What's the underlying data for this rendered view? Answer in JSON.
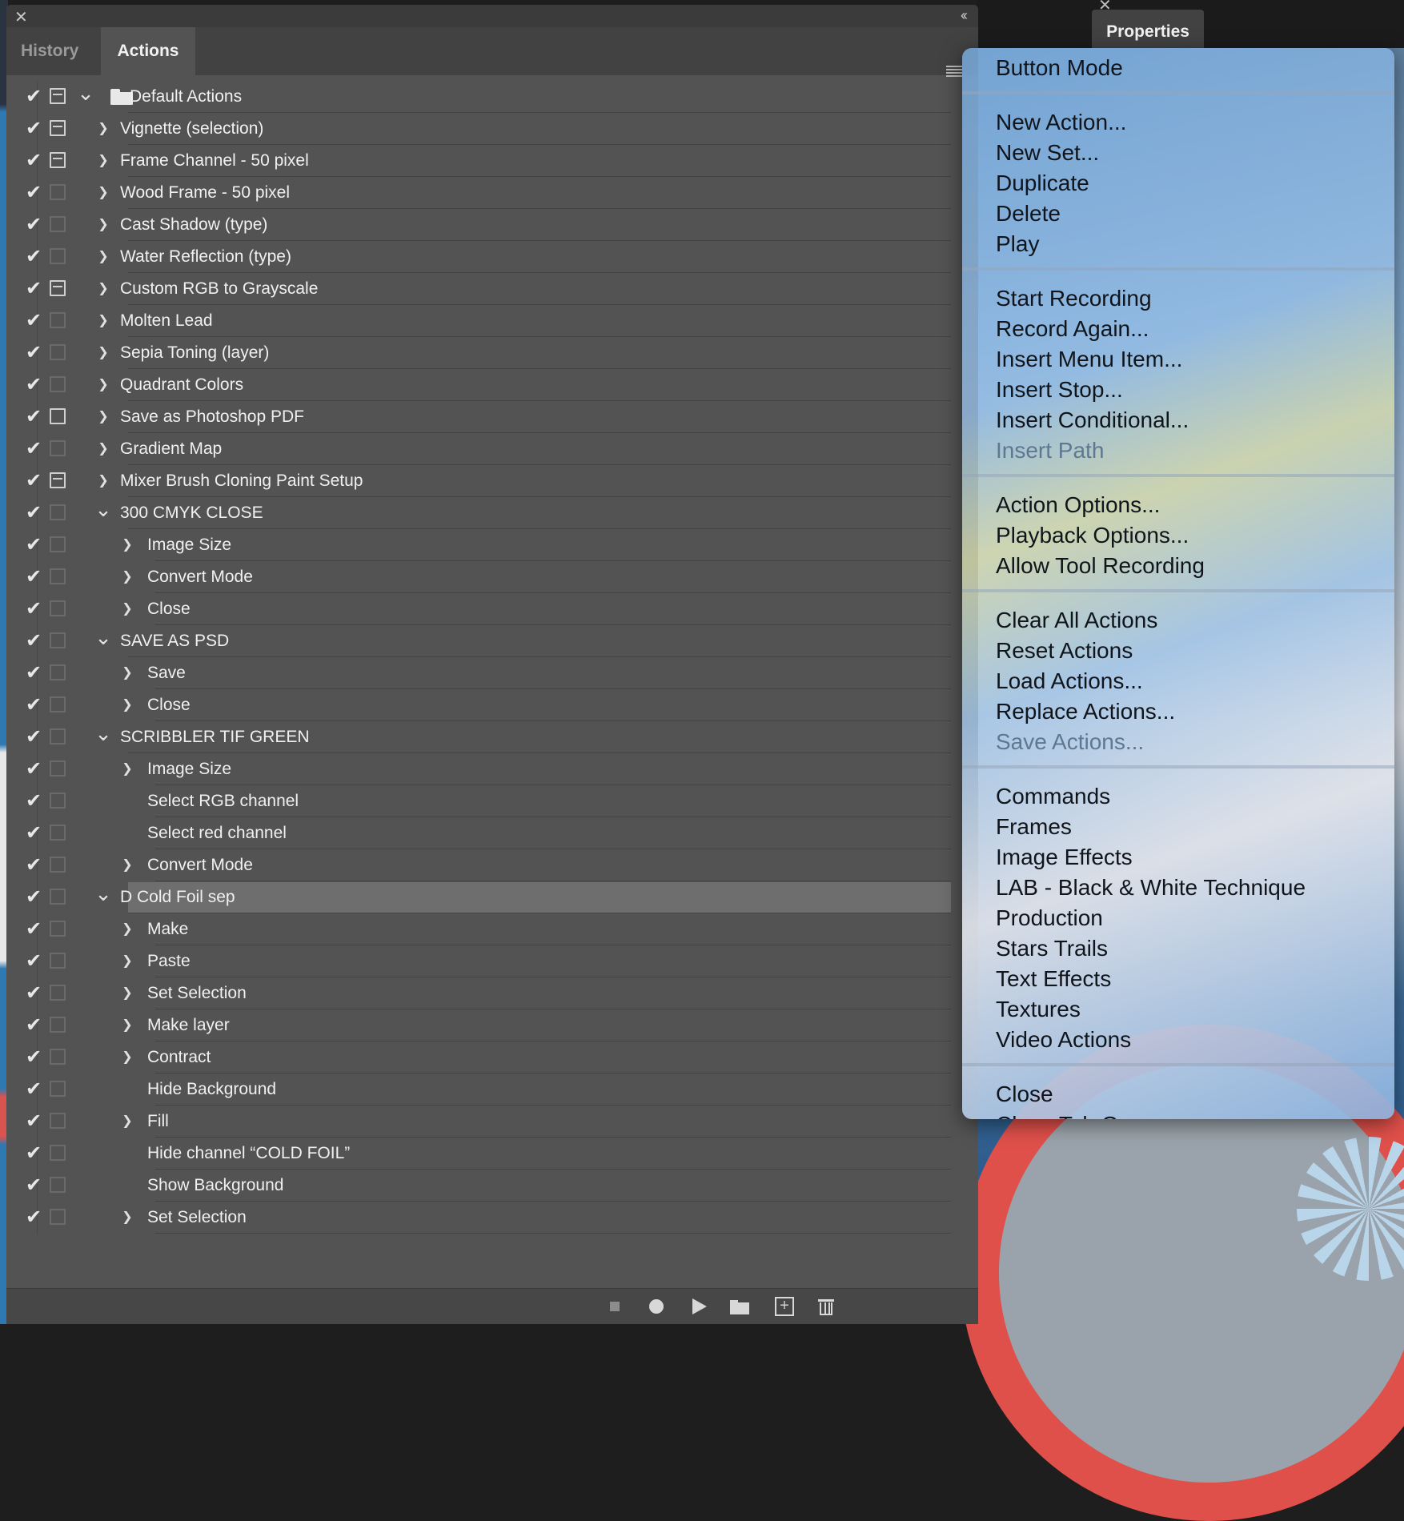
{
  "panel": {
    "tabs": [
      {
        "label": "History",
        "active": false
      },
      {
        "label": "Actions",
        "active": true
      }
    ],
    "close_glyph": "✕",
    "collapse_glyph": "‹‹"
  },
  "properties_tab": {
    "label": "Properties"
  },
  "actions": [
    {
      "label": "Default Actions",
      "level": 0,
      "kind": "set",
      "expanded": true,
      "dialog": true,
      "checked": true
    },
    {
      "label": "Vignette (selection)",
      "level": 0,
      "expanded": false,
      "dialog": true,
      "checked": true
    },
    {
      "label": "Frame Channel - 50 pixel",
      "level": 0,
      "expanded": false,
      "dialog": true,
      "checked": true
    },
    {
      "label": "Wood Frame - 50 pixel",
      "level": 0,
      "expanded": false,
      "dialog": false,
      "checked": true
    },
    {
      "label": "Cast Shadow (type)",
      "level": 0,
      "expanded": false,
      "dialog": false,
      "checked": true
    },
    {
      "label": "Water Reflection (type)",
      "level": 0,
      "expanded": false,
      "dialog": false,
      "checked": true
    },
    {
      "label": "Custom RGB to Grayscale",
      "level": 0,
      "expanded": false,
      "dialog": true,
      "checked": true
    },
    {
      "label": "Molten Lead",
      "level": 0,
      "expanded": false,
      "dialog": false,
      "checked": true
    },
    {
      "label": "Sepia Toning (layer)",
      "level": 0,
      "expanded": false,
      "dialog": false,
      "checked": true
    },
    {
      "label": "Quadrant Colors",
      "level": 0,
      "expanded": false,
      "dialog": false,
      "checked": true
    },
    {
      "label": "Save as Photoshop PDF",
      "level": 0,
      "expanded": false,
      "dialog": "empty-on",
      "checked": true
    },
    {
      "label": "Gradient Map",
      "level": 0,
      "expanded": false,
      "dialog": false,
      "checked": true
    },
    {
      "label": "Mixer Brush Cloning Paint Setup",
      "level": 0,
      "expanded": false,
      "dialog": true,
      "checked": true
    },
    {
      "label": "300 CMYK CLOSE",
      "level": 0,
      "expanded": true,
      "dialog": false,
      "checked": true
    },
    {
      "label": "Image Size",
      "level": 1,
      "expanded": false,
      "dialog": false,
      "checked": true
    },
    {
      "label": "Convert Mode",
      "level": 1,
      "expanded": false,
      "dialog": false,
      "checked": true
    },
    {
      "label": "Close",
      "level": 1,
      "expanded": false,
      "dialog": false,
      "checked": true
    },
    {
      "label": "SAVE AS PSD",
      "level": 0,
      "expanded": true,
      "dialog": false,
      "checked": true
    },
    {
      "label": "Save",
      "level": 1,
      "expanded": false,
      "dialog": false,
      "checked": true
    },
    {
      "label": "Close",
      "level": 1,
      "expanded": false,
      "dialog": false,
      "checked": true
    },
    {
      "label": "SCRIBBLER TIF GREEN",
      "level": 0,
      "expanded": true,
      "dialog": false,
      "checked": true
    },
    {
      "label": "Image Size",
      "level": 1,
      "expanded": false,
      "dialog": false,
      "checked": true
    },
    {
      "label": "Select RGB channel",
      "level": 1,
      "expanded": null,
      "dialog": false,
      "checked": true
    },
    {
      "label": "Select red channel",
      "level": 1,
      "expanded": null,
      "dialog": false,
      "checked": true
    },
    {
      "label": "Convert Mode",
      "level": 1,
      "expanded": false,
      "dialog": false,
      "checked": true
    },
    {
      "label": "D Cold Foil sep",
      "level": 0,
      "expanded": true,
      "dialog": false,
      "checked": true,
      "selected": true
    },
    {
      "label": "Make",
      "level": 1,
      "expanded": false,
      "dialog": false,
      "checked": true
    },
    {
      "label": "Paste",
      "level": 1,
      "expanded": false,
      "dialog": false,
      "checked": true
    },
    {
      "label": "Set Selection",
      "level": 1,
      "expanded": false,
      "dialog": false,
      "checked": true
    },
    {
      "label": "Make layer",
      "level": 1,
      "expanded": false,
      "dialog": false,
      "checked": true
    },
    {
      "label": "Contract",
      "level": 1,
      "expanded": false,
      "dialog": false,
      "checked": true
    },
    {
      "label": "Hide Background",
      "level": 1,
      "expanded": null,
      "dialog": false,
      "checked": true
    },
    {
      "label": "Fill",
      "level": 1,
      "expanded": false,
      "dialog": false,
      "checked": true
    },
    {
      "label": "Hide channel “COLD FOIL”",
      "level": 1,
      "expanded": null,
      "dialog": false,
      "checked": true
    },
    {
      "label": "Show Background",
      "level": 1,
      "expanded": null,
      "dialog": false,
      "checked": true
    },
    {
      "label": "Set Selection",
      "level": 1,
      "expanded": false,
      "dialog": false,
      "checked": true
    }
  ],
  "bottom_bar": [
    "stop-icon",
    "record-icon",
    "play-icon",
    "new-set-icon",
    "new-action-icon",
    "trash-icon"
  ],
  "menu": {
    "groups": [
      [
        {
          "label": "Button Mode"
        }
      ],
      [
        {
          "label": "New Action..."
        },
        {
          "label": "New Set..."
        },
        {
          "label": "Duplicate"
        },
        {
          "label": "Delete"
        },
        {
          "label": "Play"
        }
      ],
      [
        {
          "label": "Start Recording"
        },
        {
          "label": "Record Again..."
        },
        {
          "label": "Insert Menu Item..."
        },
        {
          "label": "Insert Stop..."
        },
        {
          "label": "Insert Conditional..."
        },
        {
          "label": "Insert Path",
          "disabled": true
        }
      ],
      [
        {
          "label": "Action Options..."
        },
        {
          "label": "Playback Options..."
        },
        {
          "label": "Allow Tool Recording"
        }
      ],
      [
        {
          "label": "Clear All Actions"
        },
        {
          "label": "Reset Actions"
        },
        {
          "label": "Load Actions..."
        },
        {
          "label": "Replace Actions..."
        },
        {
          "label": "Save Actions...",
          "disabled": true
        }
      ],
      [
        {
          "label": "Commands"
        },
        {
          "label": "Frames"
        },
        {
          "label": "Image Effects"
        },
        {
          "label": "LAB - Black & White Technique"
        },
        {
          "label": "Production"
        },
        {
          "label": "Stars Trails"
        },
        {
          "label": "Text Effects"
        },
        {
          "label": "Textures"
        },
        {
          "label": "Video Actions"
        }
      ],
      [
        {
          "label": "Close"
        },
        {
          "label": "Close Tab Group"
        }
      ]
    ]
  }
}
